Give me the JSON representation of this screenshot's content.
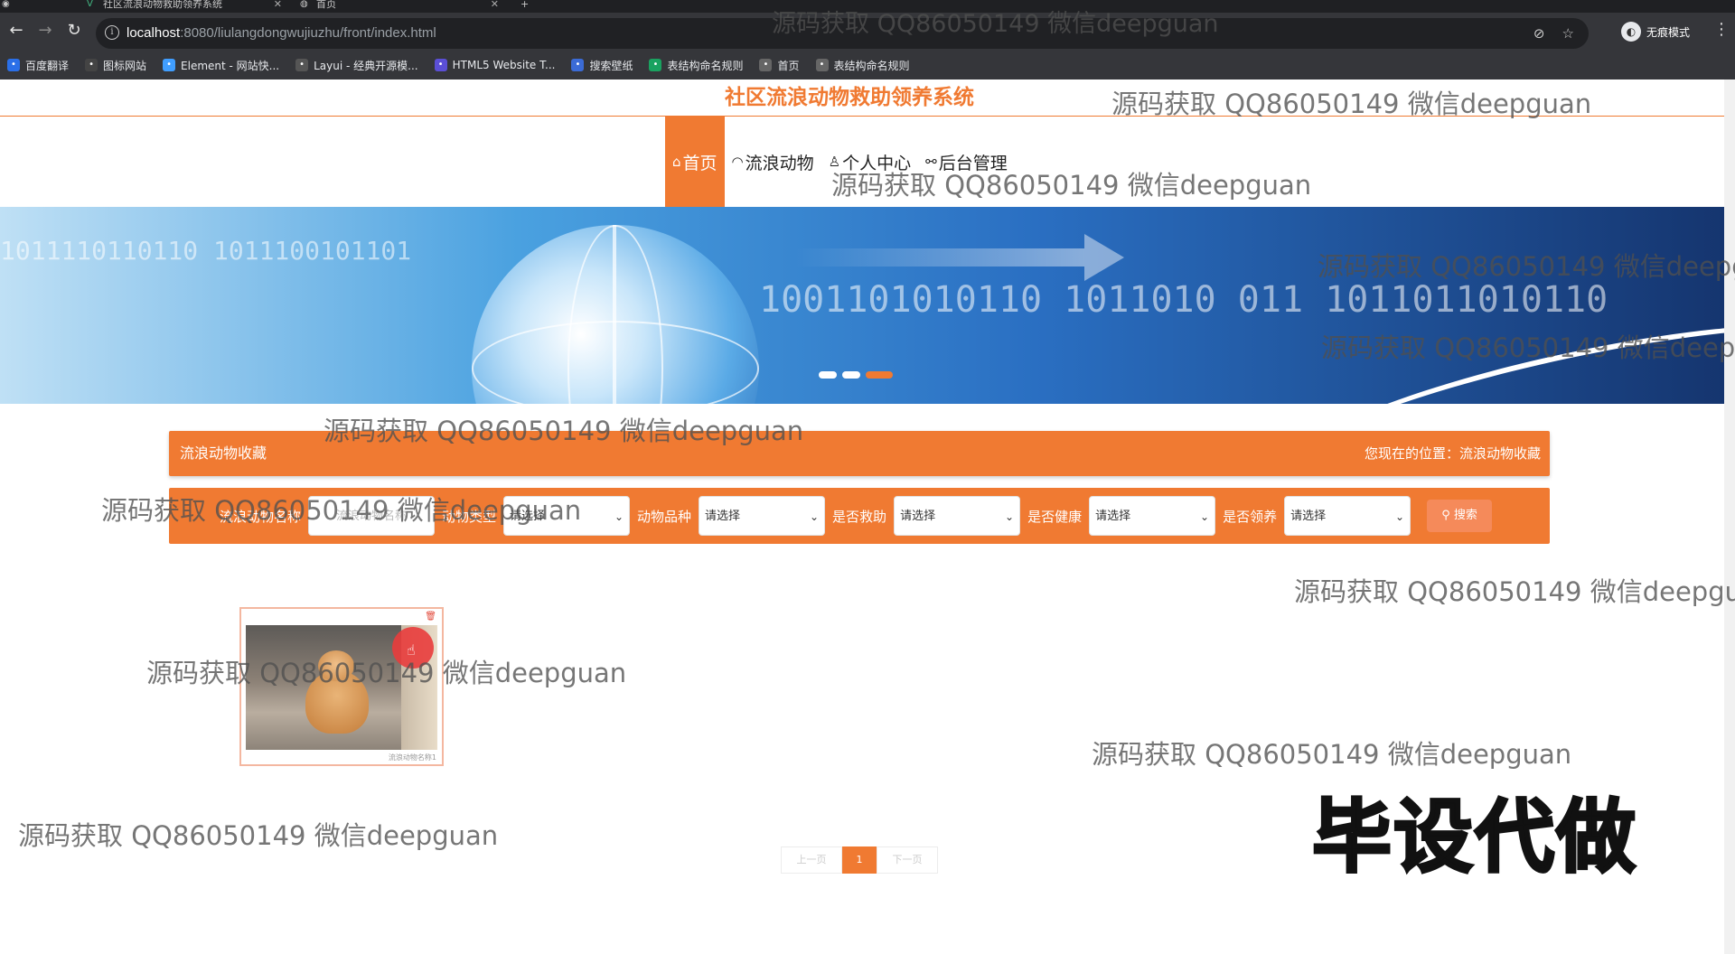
{
  "browser": {
    "tabs": [
      {
        "title": "社区流浪动物救助领养系统"
      },
      {
        "title": "首页"
      }
    ],
    "url_host": "localhost",
    "url_path": ":8080/liulangdongwujiuzhu/front/index.html",
    "incognito_label": "无痕模式",
    "bookmarks": [
      {
        "label": "百度翻译",
        "icon": "baidu-translate-icon",
        "color": "#2a6fe8"
      },
      {
        "label": "图标网站",
        "icon": "flag-icon",
        "color": "#444444"
      },
      {
        "label": "Element - 网站快...",
        "icon": "element-icon",
        "color": "#409eff"
      },
      {
        "label": "Layui - 经典开源模...",
        "icon": "layui-icon",
        "color": "#555555"
      },
      {
        "label": "HTML5 Website T...",
        "icon": "html5-icon",
        "color": "#5b4fd6"
      },
      {
        "label": "搜索壁纸",
        "icon": "wallpaper-icon",
        "color": "#3b6bd6"
      },
      {
        "label": "表结构命名规则",
        "icon": "sheet-icon",
        "color": "#1aa260"
      },
      {
        "label": "首页",
        "icon": "globe-icon",
        "color": "#666666"
      },
      {
        "label": "表结构命名规则",
        "icon": "globe-icon",
        "color": "#666666"
      }
    ]
  },
  "site": {
    "title": "社区流浪动物救助领养系统",
    "accent": "#f07a32",
    "nav": [
      {
        "label": "首页",
        "icon": "home-icon",
        "active": true
      },
      {
        "label": "流浪动物",
        "icon": "pet-icon",
        "active": false
      },
      {
        "label": "个人中心",
        "icon": "user-icon",
        "active": false
      },
      {
        "label": "后台管理",
        "icon": "link-icon",
        "active": false
      }
    ],
    "banner": {
      "binary_1": "1011110110110   1011100101101",
      "binary_2": "1001101010110   1011010  011   1011011010110"
    }
  },
  "breadcrumb": {
    "title": "流浪动物收藏",
    "position_label": "您现在的位置：",
    "position_value": "流浪动物收藏"
  },
  "filters": {
    "name_label": "流浪动物名称",
    "name_placeholder": "流浪动物名称",
    "fields": [
      {
        "label": "动物类型",
        "value": "请选择"
      },
      {
        "label": "动物品种",
        "value": "请选择"
      },
      {
        "label": "是否救助",
        "value": "请选择"
      },
      {
        "label": "是否健康",
        "value": "请选择"
      },
      {
        "label": "是否领养",
        "value": "请选择"
      }
    ],
    "search_label": "搜索"
  },
  "cards": [
    {
      "caption": "流浪动物名称1"
    }
  ],
  "pagination": {
    "prev": "上一页",
    "current": "1",
    "next": "下一页"
  },
  "watermarks": {
    "text": "源码获取 QQ86050149 微信deepguan",
    "big": "毕设代做"
  }
}
